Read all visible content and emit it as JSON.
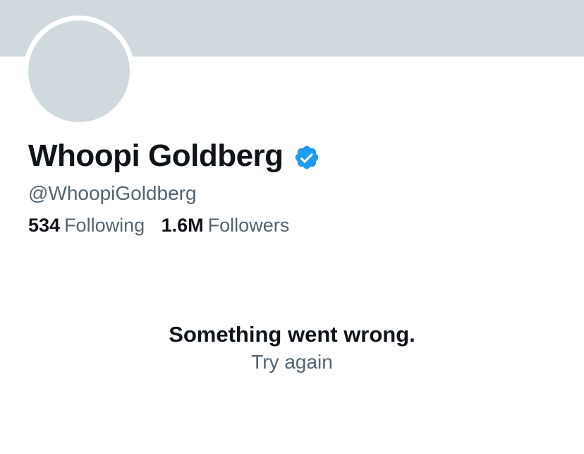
{
  "profile": {
    "display_name": "Whoopi Goldberg",
    "handle": "@WhoopiGoldberg",
    "verified": true,
    "following_count": "534",
    "following_label": "Following",
    "followers_count": "1.6M",
    "followers_label": "Followers"
  },
  "error": {
    "message": "Something went wrong.",
    "retry_label": "Try again"
  },
  "colors": {
    "banner": "#cfd9de",
    "avatar_placeholder": "#cfd9de",
    "verified_badge": "#1d9bf0",
    "primary_text": "#0f1419",
    "secondary_text": "#536471"
  },
  "icons": {
    "verified": "verified-badge-icon"
  }
}
